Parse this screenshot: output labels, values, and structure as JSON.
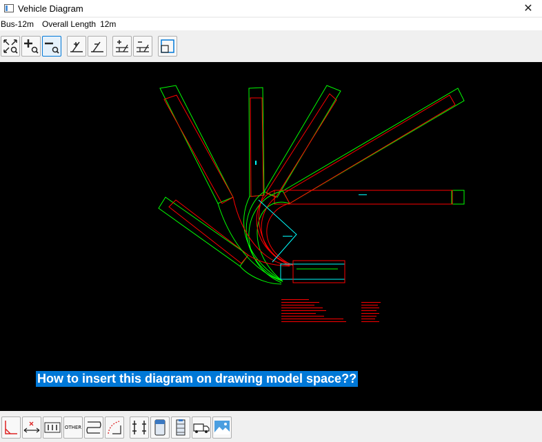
{
  "window": {
    "title": "Vehicle Diagram",
    "close_glyph": "✕"
  },
  "info": {
    "vehicle": "Bus-12m",
    "overall_length_label": "Overall Length",
    "overall_length_value": "12m"
  },
  "toolbar": {
    "buttons": [
      {
        "name": "zoom-extents-icon"
      },
      {
        "name": "zoom-in-icon"
      },
      {
        "name": "zoom-out-icon"
      },
      {
        "name": "increase-angle-icon"
      },
      {
        "name": "decrease-angle-icon"
      },
      {
        "name": "increase-offset-icon"
      },
      {
        "name": "decrease-offset-icon"
      },
      {
        "name": "window-frame-icon"
      }
    ]
  },
  "caption": "How to insert this diagram on drawing model space??",
  "bottombar": {
    "other_label": "OTHER",
    "buttons": [
      {
        "name": "angle-tool-icon"
      },
      {
        "name": "dimension-icon"
      },
      {
        "name": "axle-tool-icon"
      },
      {
        "name": "other-tool-icon"
      },
      {
        "name": "path-tool-icon"
      },
      {
        "name": "arc-tool-icon"
      },
      {
        "name": "frame-tool-icon"
      },
      {
        "name": "bus-tool-icon"
      },
      {
        "name": "trailer-tool-icon"
      },
      {
        "name": "truck-tool-icon"
      },
      {
        "name": "image-tool-icon"
      }
    ]
  },
  "colors": {
    "canvas_bg": "#000000",
    "envelope_outer": "#00ff00",
    "envelope_inner": "#ff0000",
    "vehicle_outline": "#00ffff",
    "caption_bg": "#0078d7"
  }
}
